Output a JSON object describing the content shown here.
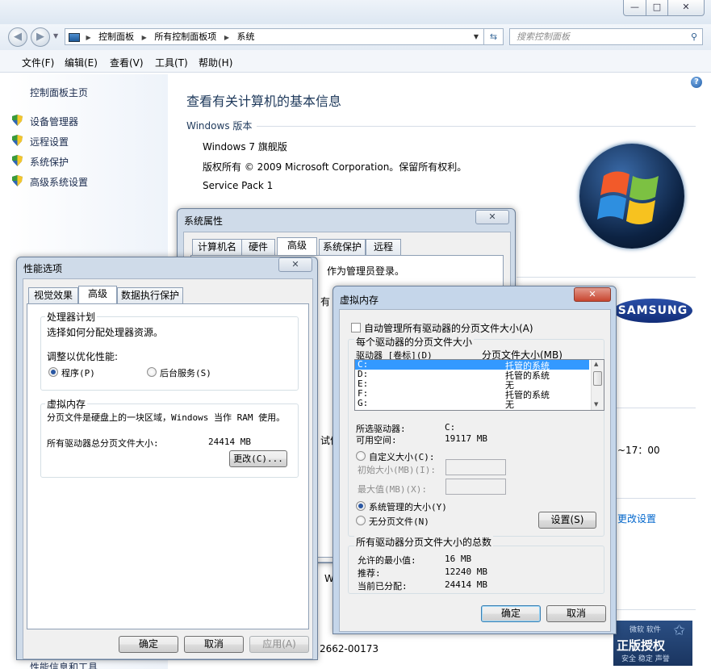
{
  "window": {
    "minimize": "—",
    "maximize": "□",
    "close": "✕"
  },
  "address": {
    "crumbs": [
      "控制面板",
      "所有控制面板项",
      "系统"
    ],
    "search_placeholder": "搜索控制面板"
  },
  "menu": [
    "文件(F)",
    "编辑(E)",
    "查看(V)",
    "工具(T)",
    "帮助(H)"
  ],
  "sidebar": {
    "home": "控制面板主页",
    "items": [
      "设备管理器",
      "远程设置",
      "系统保护",
      "高级系统设置"
    ],
    "bottom_partial": "性能信息和工具"
  },
  "main": {
    "heading": "查看有关计算机的基本信息",
    "section_windows": "Windows 版本",
    "edition": "Windows 7 旗舰版",
    "copyright": "版权所有 © 2009 Microsoft Corporation。保留所有权利。",
    "service_pack": "Service Pack 1",
    "peek_time": "~17：00",
    "peek_change": "更改设置",
    "peek_w": "W",
    "product_id_partial": "2662-00173",
    "manufacturer_logo": "SAMSUNG",
    "genuine_text": "正版授权",
    "genuine_small": "微软 软件",
    "genuine_sub": "安全 稳定 声誉"
  },
  "sysprops": {
    "title": "系统属性",
    "tabs": [
      "计算机名",
      "硬件",
      "高级",
      "系统保护",
      "远程"
    ],
    "line1": "作为管理员登录。",
    "peek_left": "有",
    "peek_mid": "试信"
  },
  "perf": {
    "title": "性能选项",
    "tabs": [
      "视觉效果",
      "高级",
      "数据执行保护"
    ],
    "scheduling_title": "处理器计划",
    "scheduling_desc": "选择如何分配处理器资源。",
    "adjust_label": "调整以优化性能:",
    "opt_programs": "程序(P)",
    "opt_services": "后台服务(S)",
    "vm_title": "虚拟内存",
    "vm_desc": "分页文件是硬盘上的一块区域，Windows 当作 RAM 使用。",
    "vm_total_label": "所有驱动器总分页文件大小:",
    "vm_total_value": "24414 MB",
    "change_button": "更改(C)...",
    "ok": "确定",
    "cancel": "取消",
    "apply": "应用(A)"
  },
  "vm": {
    "title": "虚拟内存",
    "auto_manage": "自动管理所有驱动器的分页文件大小(A)",
    "per_drive": "每个驱动器的分页文件大小",
    "col_drive": "驱动器 [卷标](D)",
    "col_size": "分页文件大小(MB)",
    "drives": [
      {
        "drive": "C:",
        "size": "托管的系统"
      },
      {
        "drive": "D:",
        "size": "托管的系统"
      },
      {
        "drive": "E:",
        "size": "无"
      },
      {
        "drive": "F:",
        "size": "托管的系统"
      },
      {
        "drive": "G:",
        "size": "无"
      }
    ],
    "selected_label": "所选驱动器:",
    "selected_value": "C:",
    "free_label": "可用空间:",
    "free_value": "19117 MB",
    "custom": "自定义大小(C):",
    "initial": "初始大小(MB)(I):",
    "max": "最大值(MB)(X):",
    "system_managed": "系统管理的大小(Y)",
    "no_paging": "无分页文件(N)",
    "set_button": "设置(S)",
    "totals_title": "所有驱动器分页文件大小的总数",
    "min_label": "允许的最小值:",
    "min_value": "16 MB",
    "rec_label": "推荐:",
    "rec_value": "12240 MB",
    "cur_label": "当前已分配:",
    "cur_value": "24414 MB",
    "ok": "确定",
    "cancel": "取消"
  }
}
